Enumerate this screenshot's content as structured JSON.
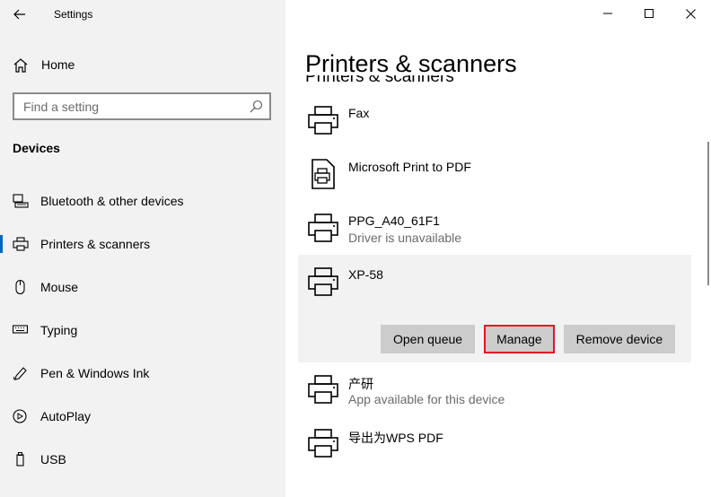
{
  "window": {
    "title": "Settings",
    "colors": {
      "accent": "#0067c0",
      "sidebar_bg": "#f2f2f2",
      "focus_outline": "#e81123"
    }
  },
  "sidebar": {
    "home_label": "Home",
    "search_placeholder": "Find a setting",
    "section_title": "Devices",
    "items": [
      {
        "label": "Bluetooth & other devices",
        "icon": "bluetooth-devices-icon"
      },
      {
        "label": "Printers & scanners",
        "icon": "printer-icon",
        "active": true
      },
      {
        "label": "Mouse",
        "icon": "mouse-icon"
      },
      {
        "label": "Typing",
        "icon": "keyboard-icon"
      },
      {
        "label": "Pen & Windows Ink",
        "icon": "pen-icon"
      },
      {
        "label": "AutoPlay",
        "icon": "autoplay-icon"
      },
      {
        "label": "USB",
        "icon": "usb-icon"
      }
    ]
  },
  "main": {
    "page_title": "Printers & scanners",
    "ghost_title": "Printers & scanners",
    "devices": [
      {
        "name": "Fax",
        "status": "",
        "icon": "printer-icon"
      },
      {
        "name": "Microsoft Print to PDF",
        "status": "",
        "icon": "pdf-printer-icon"
      },
      {
        "name": "PPG_A40_61F1",
        "status": "Driver is unavailable",
        "icon": "printer-icon"
      },
      {
        "name": "XP-58",
        "status": "",
        "icon": "printer-icon",
        "selected": true
      },
      {
        "name": "产研",
        "status": "App available for this device",
        "icon": "printer-icon"
      },
      {
        "name": "导出为WPS PDF",
        "status": "",
        "icon": "printer-icon"
      }
    ],
    "actions": {
      "open_queue": "Open queue",
      "manage": "Manage",
      "remove_device": "Remove device"
    }
  }
}
